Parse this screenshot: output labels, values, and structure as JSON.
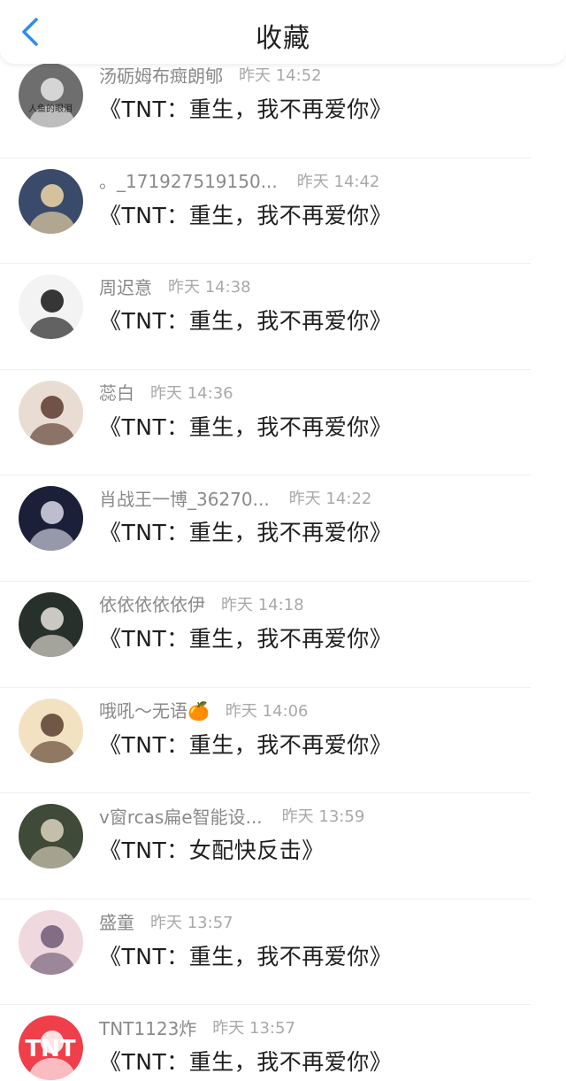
{
  "header": {
    "title": "收藏",
    "back_icon": "chevron-left-icon",
    "accent_color": "#2d8cf0"
  },
  "items": [
    {
      "username": "汤砺姆布癍朗郇",
      "time": "昨天 14:52",
      "title": "《TNT：重生，我不再爱你》",
      "avatar_text": "人鱼的眼泪",
      "avatar_colors": [
        "#6e6e6e",
        "#e8e8e8"
      ]
    },
    {
      "username": "。_171927519150...",
      "time": "昨天 14:42",
      "title": "《TNT：重生，我不再爱你》",
      "avatar_text": "",
      "avatar_colors": [
        "#3a4a6a",
        "#f1d7a4"
      ]
    },
    {
      "username": "周迟意",
      "time": "昨天 14:38",
      "title": "《TNT：重生，我不再爱你》",
      "avatar_text": "",
      "avatar_colors": [
        "#f3f3f3",
        "#141414"
      ]
    },
    {
      "username": "蕊白",
      "time": "昨天 14:36",
      "title": "《TNT：重生，我不再爱你》",
      "avatar_text": "",
      "avatar_colors": [
        "#e9dcd2",
        "#5a3b2e"
      ]
    },
    {
      "username": "肖战王一博_36270...",
      "time": "昨天 14:22",
      "title": "《TNT：重生，我不再爱你》",
      "avatar_text": "",
      "avatar_colors": [
        "#1c1f38",
        "#d9dbe8"
      ]
    },
    {
      "username": "依依依依依伊",
      "time": "昨天 14:18",
      "title": "《TNT：重生，我不再爱你》",
      "avatar_text": "",
      "avatar_colors": [
        "#27302a",
        "#e8e4dc"
      ]
    },
    {
      "username": "哦吼～无语🍊",
      "time": "昨天 14:06",
      "title": "《TNT：重生，我不再爱你》",
      "avatar_text": "",
      "avatar_colors": [
        "#f2e2c2",
        "#5a4030"
      ]
    },
    {
      "username": "v窗rcas扁e智能设...",
      "time": "昨天 13:59",
      "title": "《TNT：女配快反击》",
      "avatar_text": "",
      "avatar_colors": [
        "#3f4a38",
        "#dcd2c0"
      ]
    },
    {
      "username": "盛童",
      "time": "昨天 13:57",
      "title": "《TNT：重生，我不再爱你》",
      "avatar_text": "",
      "avatar_colors": [
        "#efd8de",
        "#6e5a74"
      ]
    },
    {
      "username": "TNT1123炸",
      "time": "昨天 13:57",
      "title": "《TNT：重生，我不再爱你》",
      "avatar_text": "TNT",
      "avatar_colors": [
        "#ef3f4a",
        "#ffffff"
      ]
    }
  ]
}
